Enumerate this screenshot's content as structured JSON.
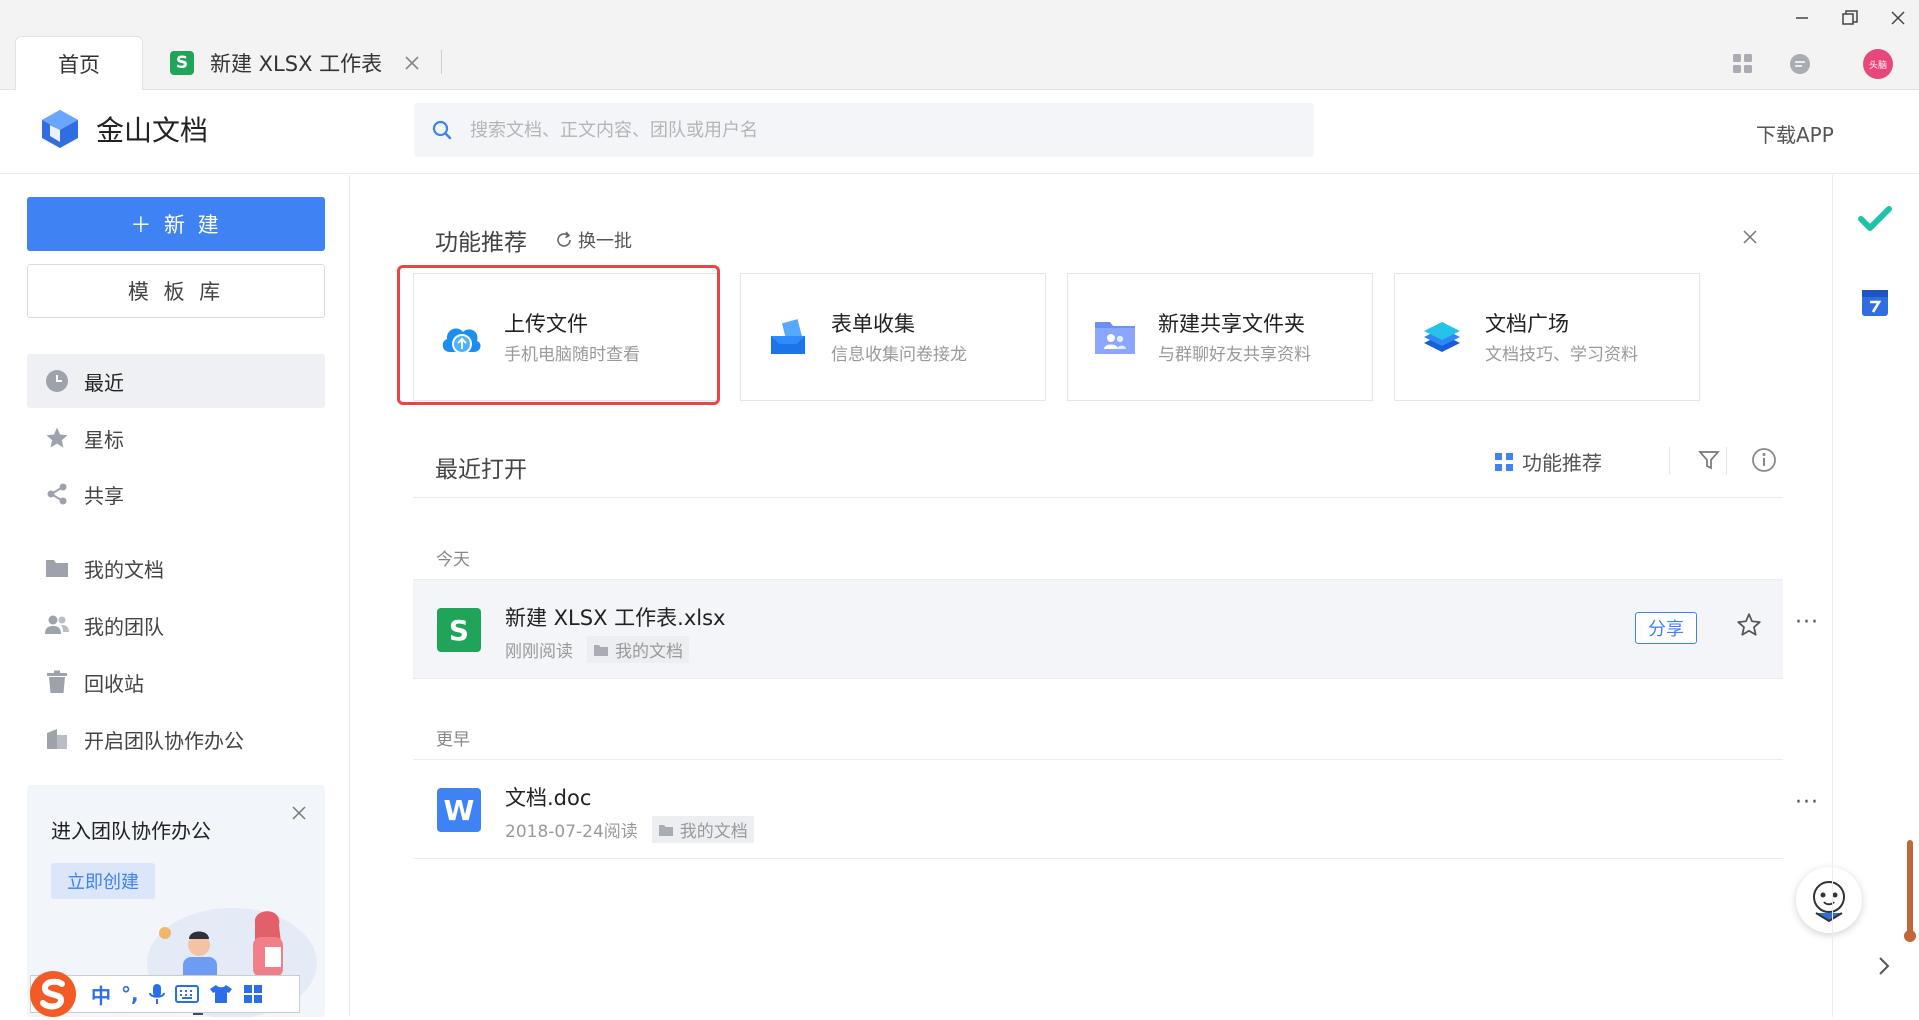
{
  "tabs": {
    "home": "首页",
    "doc": "新建 XLSX 工作表"
  },
  "xlsx_letter": "S",
  "doc_letter": "W",
  "avatar_text": "头脑",
  "brand": {
    "name": "金山文档"
  },
  "search": {
    "placeholder": "搜索文档、正文内容、团队或用户名"
  },
  "download_app": "下载APP",
  "sidebar": {
    "new_label": "＋ 新 建",
    "template_label": "模 板 库",
    "items": [
      "最近",
      "星标",
      "共享",
      "我的文档",
      "我的团队",
      "回收站",
      "开启团队协作办公"
    ]
  },
  "promo": {
    "title": "进入团队协作办公",
    "button": "立即创建"
  },
  "ime": {
    "lang": "中"
  },
  "features": {
    "title": "功能推荐",
    "refresh": "换一批",
    "cards": [
      {
        "title": "上传文件",
        "subtitle": "手机电脑随时查看"
      },
      {
        "title": "表单收集",
        "subtitle": "信息收集问卷接龙"
      },
      {
        "title": "新建共享文件夹",
        "subtitle": "与群聊好友共享资料"
      },
      {
        "title": "文档广场",
        "subtitle": "文档技巧、学习资料"
      }
    ]
  },
  "recent": {
    "title": "最近打开",
    "tool_label": "功能推荐",
    "groups": [
      {
        "label": "今天",
        "files": [
          {
            "name": "新建 XLSX 工作表.xlsx",
            "time": "刚刚阅读",
            "location": "我的文档",
            "share": "分享"
          }
        ]
      },
      {
        "label": "更早",
        "files": [
          {
            "name": "文档.doc",
            "time": "2018-07-24阅读",
            "location": "我的文档"
          }
        ]
      }
    ]
  },
  "more_dots": "···",
  "colors": {
    "accent": "#3f82f4",
    "xlsx": "#1fa45a",
    "doc": "#3f82f4",
    "highlight": "#e84646"
  }
}
